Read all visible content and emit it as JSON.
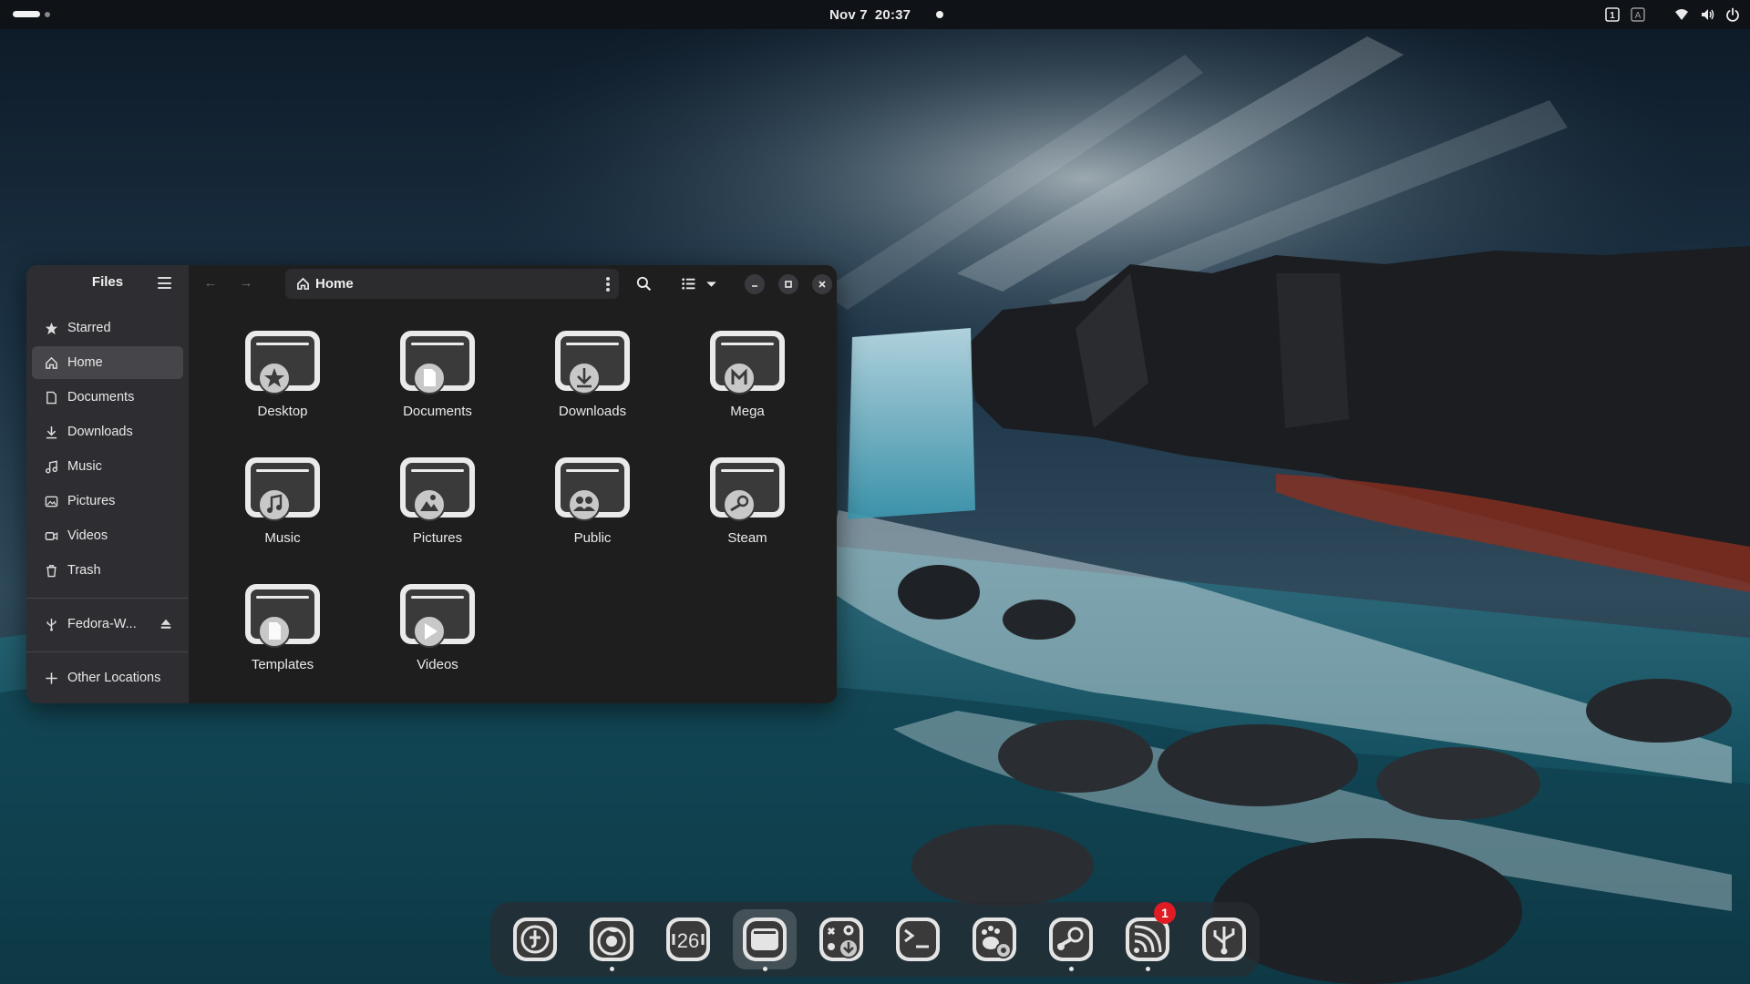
{
  "topbar": {
    "date": "Nov 7",
    "time": "20:37",
    "tray_icons": [
      "keyboard-layout-icon",
      "accessibility-icon",
      "wifi-icon",
      "volume-icon",
      "power-icon"
    ],
    "tray_badges": [
      "1",
      "A"
    ]
  },
  "window": {
    "app_title": "Files",
    "path": "Home",
    "sidebar": {
      "items": [
        {
          "label": "Starred",
          "icon": "star-icon"
        },
        {
          "label": "Home",
          "icon": "home-icon",
          "active": true
        },
        {
          "label": "Documents",
          "icon": "document-icon"
        },
        {
          "label": "Downloads",
          "icon": "download-icon"
        },
        {
          "label": "Music",
          "icon": "music-icon"
        },
        {
          "label": "Pictures",
          "icon": "picture-icon"
        },
        {
          "label": "Videos",
          "icon": "video-icon"
        },
        {
          "label": "Trash",
          "icon": "trash-icon"
        }
      ],
      "drive": {
        "label": "Fedora-W...",
        "icon": "usb-icon"
      },
      "other": {
        "label": "Other Locations",
        "icon": "plus-icon"
      }
    },
    "files": [
      {
        "label": "Desktop",
        "emblem": "star"
      },
      {
        "label": "Documents",
        "emblem": "document"
      },
      {
        "label": "Downloads",
        "emblem": "download"
      },
      {
        "label": "Mega",
        "emblem": "mega"
      },
      {
        "label": "Music",
        "emblem": "music"
      },
      {
        "label": "Pictures",
        "emblem": "pictures"
      },
      {
        "label": "Public",
        "emblem": "people"
      },
      {
        "label": "Steam",
        "emblem": "steam"
      },
      {
        "label": "Templates",
        "emblem": "document"
      },
      {
        "label": "Videos",
        "emblem": "play"
      }
    ]
  },
  "dock": {
    "apps": [
      {
        "name": "fedora-media-writer",
        "running": false,
        "active": false
      },
      {
        "name": "firefox",
        "running": true,
        "active": false
      },
      {
        "name": "calendar",
        "label": "26",
        "running": false,
        "active": false
      },
      {
        "name": "files",
        "running": true,
        "active": true
      },
      {
        "name": "software",
        "running": false,
        "active": false
      },
      {
        "name": "terminal",
        "running": false,
        "active": false
      },
      {
        "name": "gnome-tweaks",
        "running": false,
        "active": false
      },
      {
        "name": "steam",
        "running": true,
        "active": false
      },
      {
        "name": "rss-reader",
        "running": true,
        "active": false,
        "badge": "1"
      },
      {
        "name": "usb-writer",
        "running": false,
        "active": false
      }
    ]
  }
}
